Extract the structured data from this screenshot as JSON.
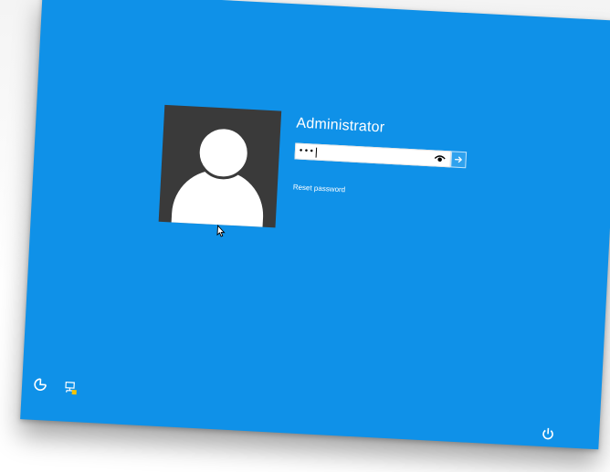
{
  "login": {
    "user_name": "Administrator",
    "password_value": "•••",
    "reset_password_label": "Reset password"
  },
  "icons": {
    "avatar": "user-silhouette-icon",
    "reveal": "eye-icon",
    "submit": "arrow-right-icon",
    "ease_of_access": "ease-of-access-icon",
    "network": "network-icon",
    "power": "power-icon",
    "cursor": "mouse-pointer-icon"
  },
  "colors": {
    "background": "#0f91e8",
    "avatar_bg": "#3a3a3a",
    "submit_button": "#2fa2ee",
    "text": "#ffffff"
  }
}
